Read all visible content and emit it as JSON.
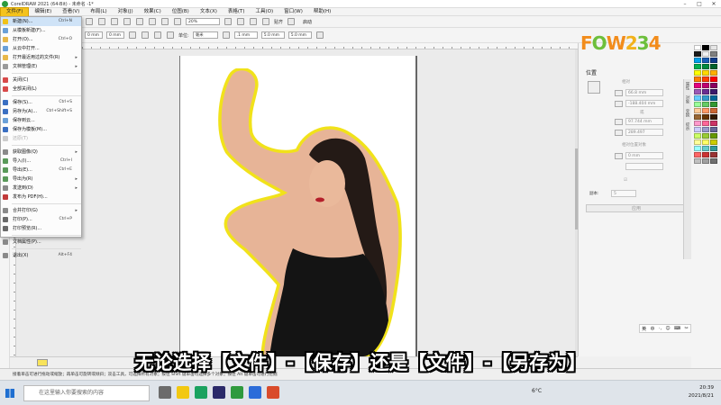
{
  "titlebar": {
    "title": "CorelDRAW 2021 (64-Bit) - 未命名 -1*"
  },
  "menubar": {
    "items": [
      {
        "label": "文件(F)"
      },
      {
        "label": "编辑(E)"
      },
      {
        "label": "查看(V)"
      },
      {
        "label": "布局(L)"
      },
      {
        "label": "对象(J)"
      },
      {
        "label": "效果(C)"
      },
      {
        "label": "位图(B)"
      },
      {
        "label": "文本(X)"
      },
      {
        "label": "表格(T)"
      },
      {
        "label": "工具(O)"
      },
      {
        "label": "窗口(W)"
      },
      {
        "label": "帮助(H)"
      }
    ]
  },
  "toolbar": {
    "zoom": "20%",
    "snap_label": "贴齐",
    "start_label": "启动",
    "width_value": "0 mm",
    "height_value": "0 mm",
    "units_label": "单位:",
    "units_value": "毫米",
    "nudge_value": ".1 mm",
    "dup_x": "5.0 mm",
    "dup_y": "5.0 mm"
  },
  "file_menu": {
    "items": [
      {
        "label": "新建(N)...",
        "shortcut": "Ctrl+N",
        "color": "#f0c21a",
        "highlight": true
      },
      {
        "label": "从模板新建(F)...",
        "shortcut": "",
        "color": "#6aa0d8"
      },
      {
        "label": "打开(O)...",
        "shortcut": "Ctrl+O",
        "color": "#e8b84a"
      },
      {
        "label": "从云中打开...",
        "shortcut": "",
        "color": "#6aa0d8"
      },
      {
        "label": "打开最近用过的文件(R)",
        "shortcut": "",
        "arrow": true,
        "color": "#e8b84a"
      },
      {
        "label": "文档管理(E)",
        "shortcut": "",
        "arrow": true,
        "color": "#9a9a9a"
      },
      {
        "sep": true
      },
      {
        "label": "关闭(C)",
        "shortcut": "",
        "color": "#d84a4a"
      },
      {
        "label": "全部关闭(L)",
        "shortcut": "",
        "color": "#d84a4a"
      },
      {
        "sep": true
      },
      {
        "label": "保存(S)...",
        "shortcut": "Ctrl+S",
        "color": "#3a6fc2"
      },
      {
        "label": "另存为(A)...",
        "shortcut": "Ctrl+Shift+S",
        "color": "#3a6fc2"
      },
      {
        "label": "保存到云...",
        "shortcut": "",
        "color": "#6aa0d8"
      },
      {
        "label": "保存为模板(M)...",
        "shortcut": "",
        "color": "#3a6fc2"
      },
      {
        "label": "还原(T)",
        "shortcut": "",
        "disabled": true,
        "color": "#cccccc"
      },
      {
        "sep": true
      },
      {
        "label": "获取图像(Q)",
        "shortcut": "",
        "arrow": true,
        "color": "#8a8a8a"
      },
      {
        "label": "导入(I)...",
        "shortcut": "Ctrl+I",
        "color": "#5a9a5a"
      },
      {
        "label": "导出(E)...",
        "shortcut": "Ctrl+E",
        "color": "#5a9a5a"
      },
      {
        "label": "导出为(R)",
        "shortcut": "",
        "arrow": true,
        "color": "#5a9a5a"
      },
      {
        "label": "发送到(D)",
        "shortcut": "",
        "arrow": true,
        "color": "#8a8a8a"
      },
      {
        "label": "发布为 PDF(H)...",
        "shortcut": "",
        "color": "#c23a3a"
      },
      {
        "sep": true
      },
      {
        "label": "合并打印(G)",
        "shortcut": "",
        "arrow": true,
        "color": "#8a8a8a"
      },
      {
        "label": "打印(P)...",
        "shortcut": "Ctrl+P",
        "color": "#6a6a6a"
      },
      {
        "label": "打印预览(R)...",
        "shortcut": "",
        "color": "#6a6a6a"
      },
      {
        "sep": true
      },
      {
        "label": "文档属性(P)...",
        "shortcut": "",
        "color": "#8a8a8a"
      },
      {
        "sep": true
      },
      {
        "label": "退出(X)",
        "shortcut": "Alt+F4",
        "color": "#8a8a8a"
      }
    ]
  },
  "docker": {
    "title": "位置",
    "relative_label": "相对",
    "x_value": "66.8 mm",
    "y_value": "-188.404 mm",
    "or_label": "或",
    "w_value": "97.744 mm",
    "h_value": "289.497",
    "pos_label": "相对位置对象",
    "offset_value": "0 mm",
    "copies_label": "副本:",
    "copies_value": "5",
    "apply_label": "应用",
    "side_tabs": [
      "属性",
      "对象",
      "变换",
      "提示"
    ]
  },
  "logo": {
    "text": "FOW234"
  },
  "palette": {
    "colors": [
      "#ffffff",
      "#000000",
      "#e6e6e6",
      "#1a1a1a",
      "#f2f2f2",
      "#808080",
      "#00a0e9",
      "#1b5eb4",
      "#0e3b8a",
      "#00b050",
      "#008a3e",
      "#00622c",
      "#ffff00",
      "#ffd700",
      "#ffb000",
      "#ff7f00",
      "#ff4000",
      "#ff0000",
      "#e4007f",
      "#c00070",
      "#8a0060",
      "#9b59b6",
      "#6a2c91",
      "#3b1a6b",
      "#66ccff",
      "#3399cc",
      "#006699",
      "#99ff99",
      "#66cc66",
      "#339933",
      "#ffcc99",
      "#ff9966",
      "#cc6633",
      "#996633",
      "#663300",
      "#331900",
      "#ff99cc",
      "#ff6699",
      "#cc3366",
      "#ccccff",
      "#9999cc",
      "#666699",
      "#ccff66",
      "#99cc33",
      "#669900",
      "#ffff99",
      "#ffff66",
      "#cccc00",
      "#99ffff",
      "#66cccc",
      "#339999",
      "#ff6666",
      "#cc3333",
      "#993333",
      "#c0c0c0",
      "#a0a0a0",
      "#707070"
    ]
  },
  "caption": {
    "text": "无论选择【文件】-【保存】还是【文件】-【另存为】"
  },
  "statusbar": {
    "text": "接着单击可进行拖动或缩放；再单击可旋转或倾斜；双击工具，可选择所有对象；按住 Shift 键单击可选择多个对象；按住 Alt 键单击可进行挖掘"
  },
  "taskbar": {
    "search_placeholder": "在这里输入你要搜索的内容",
    "weather": "6°C",
    "time": "20:39",
    "date": "2021/8/21"
  },
  "ime": {
    "items": [
      "英",
      "中",
      "·,",
      "☺",
      "⌨",
      "✂"
    ]
  }
}
